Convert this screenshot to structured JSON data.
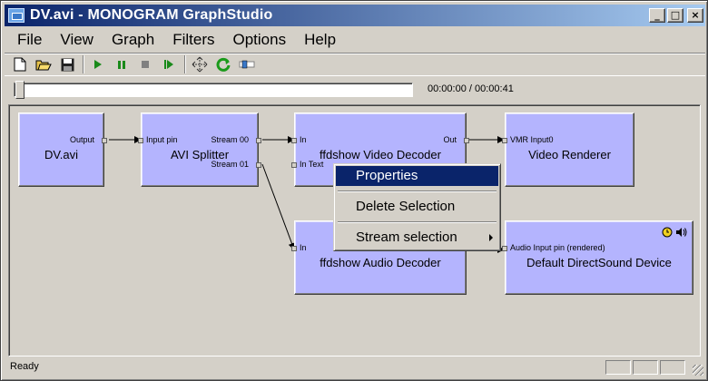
{
  "window": {
    "title": "DV.avi - MONOGRAM GraphStudio",
    "minimize_glyph": "_",
    "maximize_glyph": "□",
    "close_glyph": "×"
  },
  "menu": {
    "items": [
      "File",
      "View",
      "Graph",
      "Filters",
      "Options",
      "Help"
    ]
  },
  "toolbar": {
    "icons": [
      "new-document-icon",
      "open-folder-icon",
      "save-disk-icon",
      "play-icon",
      "pause-icon",
      "stop-icon",
      "step-frame-icon",
      "refresh-layout-icon",
      "reload-graph-icon",
      "seek-tool-icon"
    ]
  },
  "seek": {
    "time": "00:00:00 / 00:00:41",
    "position": 0
  },
  "filters": {
    "dv_avi": {
      "name": "DV.avi",
      "pins": {
        "output": "Output"
      }
    },
    "avi_splitter": {
      "name": "AVI Splitter",
      "pins": {
        "input": "Input pin",
        "stream00": "Stream 00",
        "stream01": "Stream 01"
      }
    },
    "video_decoder": {
      "name": "ffdshow Video Decoder",
      "pins": {
        "in": "In",
        "in_text": "In Text",
        "out": "Out"
      }
    },
    "video_renderer": {
      "name": "Video Renderer",
      "pins": {
        "input": "VMR Input0"
      }
    },
    "audio_decoder": {
      "name": "ffdshow Audio Decoder",
      "pins": {
        "in": "In"
      }
    },
    "dsound": {
      "name": "Default DirectSound Device",
      "pins": {
        "input": "Audio Input pin (rendered)"
      },
      "icons": [
        "clock-icon",
        "speaker-icon"
      ]
    }
  },
  "context_menu": {
    "properties": "Properties",
    "delete": "Delete Selection",
    "stream": "Stream selection",
    "highlight_color": "#0a246a"
  },
  "status": {
    "text": "Ready"
  },
  "colors": {
    "filter_fill": "#b4b4fe",
    "face": "#d4d0c8",
    "title_start": "#0a246a",
    "title_end": "#a6caf0"
  }
}
